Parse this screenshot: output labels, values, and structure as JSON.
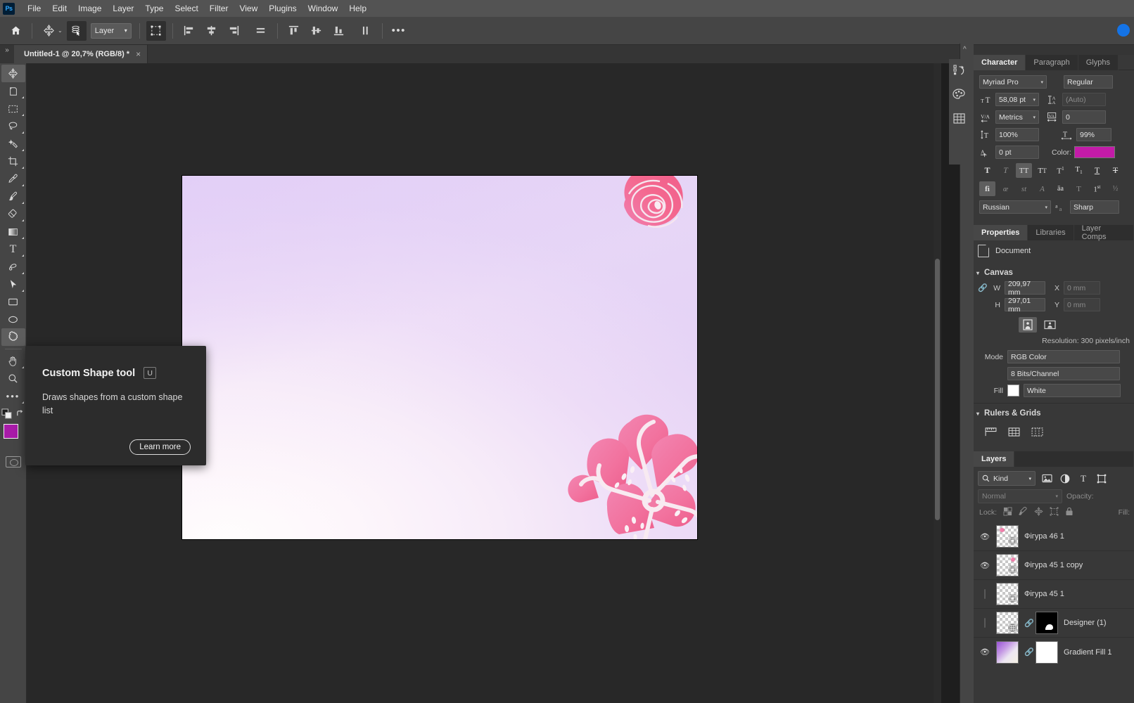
{
  "app": {
    "logo": "Ps"
  },
  "menubar": {
    "items": [
      "File",
      "Edit",
      "Image",
      "Layer",
      "Type",
      "Select",
      "Filter",
      "View",
      "Plugins",
      "Window",
      "Help"
    ]
  },
  "optionsbar": {
    "home_icon": "home-icon",
    "tool_icon": "move-tool-icon",
    "caret": "⌄",
    "autoselect_icon": "auto-select-layers-icon",
    "layer_select": "Layer",
    "transform_controls_icon": "show-transform-controls-icon",
    "align_icons": [
      "align-left-edges-icon",
      "align-horizontal-centers-icon",
      "align-right-edges-icon",
      "distribute-horizontally-icon"
    ],
    "distribute_icons": [
      "align-top-edges-icon",
      "align-vertical-centers-icon",
      "align-bottom-edges-icon",
      "distribute-vertically-icon"
    ],
    "more_label": "•••"
  },
  "tabbar": {
    "expand_label": "»",
    "document_title": "Untitled-1 @ 20,7% (RGB/8) *",
    "close_label": "×"
  },
  "toolbar": {
    "tools": [
      {
        "name": "move-tool",
        "glyph": "✥",
        "active": true,
        "corner": false
      },
      {
        "name": "artboard-tool",
        "glyph": "⬚",
        "active": false,
        "corner": true
      },
      {
        "name": "rectangular-marquee-tool",
        "glyph": "⬚",
        "active": false,
        "corner": true
      },
      {
        "name": "lasso-tool",
        "glyph": "○",
        "active": false,
        "corner": true
      },
      {
        "name": "object-selection-tool",
        "glyph": "✦",
        "active": false,
        "corner": true
      },
      {
        "name": "crop-tool",
        "glyph": "⌗",
        "active": false,
        "corner": true
      },
      {
        "name": "eyedropper-tool",
        "glyph": "✒",
        "active": false,
        "corner": true
      },
      {
        "name": "brush-tool",
        "glyph": "✎",
        "active": false,
        "corner": true
      },
      {
        "name": "eraser-tool",
        "glyph": "▭",
        "active": false,
        "corner": true
      },
      {
        "name": "gradient-tool",
        "glyph": "■",
        "active": false,
        "corner": true
      },
      {
        "name": "type-tool",
        "glyph": "T",
        "active": false,
        "corner": true
      },
      {
        "name": "pen-tool",
        "glyph": "✏",
        "active": false,
        "corner": true
      },
      {
        "name": "path-selection-tool",
        "glyph": "➤",
        "active": false,
        "corner": true
      },
      {
        "name": "rectangle-tool",
        "glyph": "▭",
        "active": false,
        "corner": false
      },
      {
        "name": "ellipse-tool",
        "glyph": "⬭",
        "active": false,
        "corner": false
      },
      {
        "name": "custom-shape-tool",
        "glyph": "❁",
        "active": true,
        "corner": false
      },
      {
        "name": "hand-tool",
        "glyph": "✋",
        "active": false,
        "corner": true
      },
      {
        "name": "zoom-tool",
        "glyph": "⌕",
        "active": false,
        "corner": false
      },
      {
        "name": "edit-toolbar",
        "glyph": "•••",
        "active": false,
        "corner": true
      }
    ],
    "default_colors_icon": "default-foreground-background-colors-icon",
    "swap_colors_icon": "swap-foreground-background-colors-icon",
    "foreground_color": "#a81ba8",
    "background_color": "#ffffff",
    "quick_mask_icon": "quick-mask-mode-icon"
  },
  "tooltip": {
    "title": "Custom Shape tool",
    "shortcut": "U",
    "description": "Draws shapes from a custom shape list",
    "learn_more": "Learn more"
  },
  "dock": {
    "collapse_icon": "collapse-panels-icon",
    "icons": [
      "history-icon",
      "color-swatches-icon",
      "tool-presets-grid-icon"
    ]
  },
  "character_panel": {
    "tabs": [
      {
        "label": "Character",
        "active": true
      },
      {
        "label": "Paragraph",
        "active": false
      },
      {
        "label": "Glyphs",
        "active": false
      }
    ],
    "font_family": "Myriad Pro",
    "font_style": "Regular",
    "font_size_icon": "font-size-icon",
    "font_size": "58,08 pt",
    "leading_icon": "leading-icon",
    "leading": "(Auto)",
    "kerning_icon": "kerning-icon",
    "kerning": "Metrics",
    "tracking_icon": "tracking-icon",
    "tracking": "0",
    "vscale_icon": "vertical-scale-icon",
    "vertical_scale": "100%",
    "hscale_icon": "horizontal-scale-icon",
    "horizontal_scale": "99%",
    "baseline_icon": "baseline-shift-icon",
    "baseline_shift": "0 pt",
    "color_label": "Color:",
    "color_value": "#c31ba8",
    "style_buttons": [
      {
        "name": "faux-bold",
        "glyph": "T",
        "on": false,
        "dim": false
      },
      {
        "name": "faux-italic",
        "glyph": "T",
        "on": false,
        "dim": true
      },
      {
        "name": "all-caps",
        "glyph": "TT",
        "on": true,
        "dim": false
      },
      {
        "name": "small-caps",
        "glyph": "Tᴛ",
        "on": false,
        "dim": false
      },
      {
        "name": "superscript",
        "glyph": "T¹",
        "on": false,
        "dim": false
      },
      {
        "name": "subscript",
        "glyph": "T₁",
        "on": false,
        "dim": false
      },
      {
        "name": "underline",
        "glyph": "T",
        "on": false,
        "dim": false
      },
      {
        "name": "strikethrough",
        "glyph": "T",
        "on": false,
        "dim": false
      }
    ],
    "opentype_buttons": [
      {
        "name": "standard-ligatures",
        "glyph": "fi",
        "on": true,
        "dim": false
      },
      {
        "name": "contextual-alternates",
        "glyph": "ᵒ⁄",
        "on": false,
        "dim": true
      },
      {
        "name": "discretionary-ligatures",
        "glyph": "st",
        "on": false,
        "dim": true
      },
      {
        "name": "swash",
        "glyph": "𝒜",
        "on": false,
        "dim": true
      },
      {
        "name": "oldstyle",
        "glyph": "aā",
        "on": false,
        "dim": false
      },
      {
        "name": "titling-alternates",
        "glyph": "T",
        "on": false,
        "dim": true
      },
      {
        "name": "ordinals",
        "glyph": "1ˢᵗ",
        "on": false,
        "dim": false
      },
      {
        "name": "fractions",
        "glyph": "½",
        "on": false,
        "dim": true
      }
    ],
    "language": "Russian",
    "antialias_icon": "anti-aliasing-icon",
    "antialias": "Sharp"
  },
  "properties_panel": {
    "tabs": [
      {
        "label": "Properties",
        "active": true
      },
      {
        "label": "Libraries",
        "active": false
      },
      {
        "label": "Layer Comps",
        "active": false
      }
    ],
    "doc_icon": "document-icon",
    "doc_label": "Document",
    "canvas_section": "Canvas",
    "w_label": "W",
    "w_value": "209,97 mm",
    "h_label": "H",
    "h_value": "297,01 mm",
    "x_label": "X",
    "x_value": "0 mm",
    "y_label": "Y",
    "y_value": "0 mm",
    "link_icon": "link-dimensions-icon",
    "orientation": [
      {
        "name": "portrait-orientation",
        "on": true
      },
      {
        "name": "landscape-orientation",
        "on": false
      }
    ],
    "resolution": "Resolution: 300 pixels/inch",
    "mode_label": "Mode",
    "mode_value": "RGB Color",
    "depth_value": "8 Bits/Channel",
    "fill_label": "Fill",
    "fill_swatch": "#ffffff",
    "fill_value": "White",
    "rulers_section": "Rulers & Grids",
    "rulers_icons": [
      "rulers-icon",
      "grid-icon",
      "guides-icon"
    ]
  },
  "layers_panel": {
    "tabs": [
      {
        "label": "Layers",
        "active": true
      }
    ],
    "filter_icon": "search-icon",
    "filter_kind": "Kind",
    "filter_buttons": [
      "pixel-layers-filter-icon",
      "adjustment-layers-filter-icon",
      "type-layers-filter-icon",
      "shape-layers-filter-icon"
    ],
    "blend_mode": "Normal",
    "opacity_label": "Opacity:",
    "lock_label": "Lock:",
    "lock_icons": [
      "lock-transparent-pixels-icon",
      "lock-image-pixels-icon",
      "lock-position-icon",
      "lock-artboard-nesting-icon",
      "lock-all-icon"
    ],
    "fill_label": "Fill:",
    "layers": [
      {
        "name": "Фігура 46 1",
        "visible": true,
        "type": "shape",
        "has_mask": false
      },
      {
        "name": "Фігура 45 1 copy",
        "visible": true,
        "type": "shape",
        "has_mask": false
      },
      {
        "name": "Фігура 45 1",
        "visible": false,
        "type": "shape",
        "has_mask": false
      },
      {
        "name": "Designer (1)",
        "visible": false,
        "type": "smart-object",
        "has_mask": true,
        "mask": "black"
      },
      {
        "name": "Gradient Fill 1",
        "visible": true,
        "type": "gradient-fill",
        "has_mask": true,
        "mask": "white"
      }
    ]
  },
  "canvas": {
    "document_name": "Untitled-1",
    "zoom": "20,7%",
    "color_mode": "RGB/8",
    "artwork_description": "Pastel pink-lavender gradient poster with outlined rose at top-right and large cherry blossom at bottom-right",
    "accent_pink": "#f2749f",
    "accent_lavender": "#e4d2f6"
  }
}
